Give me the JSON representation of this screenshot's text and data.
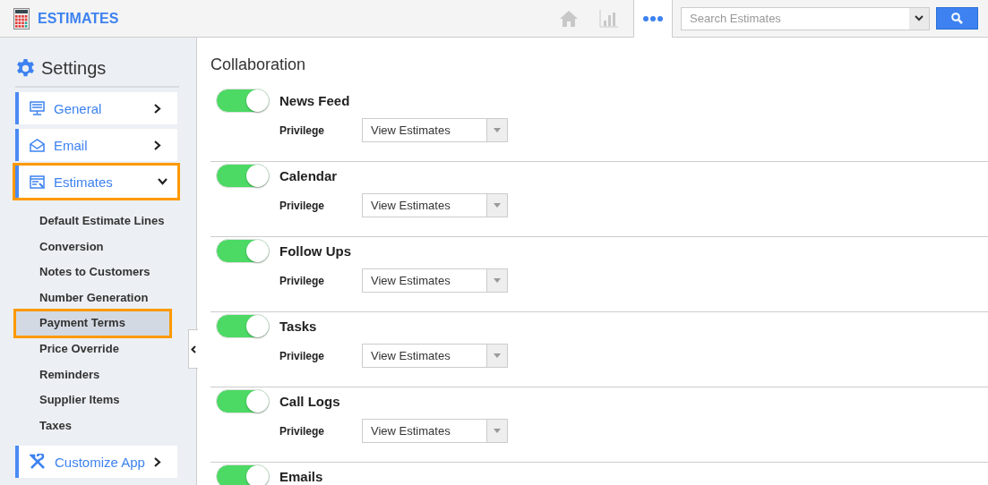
{
  "header": {
    "title": "ESTIMATES",
    "search": {
      "placeholder": "Search Estimates"
    }
  },
  "sidebar": {
    "title": "Settings",
    "items": [
      {
        "kind": "menu",
        "label": "General",
        "expanded": false,
        "highlighted": false
      },
      {
        "kind": "menu",
        "label": "Email",
        "expanded": false,
        "highlighted": false
      },
      {
        "kind": "menu",
        "label": "Estimates",
        "expanded": true,
        "highlighted": true,
        "children": [
          {
            "label": "Default Estimate Lines",
            "selected": false,
            "highlighted": false
          },
          {
            "label": "Conversion",
            "selected": false,
            "highlighted": false
          },
          {
            "label": "Notes to Customers",
            "selected": false,
            "highlighted": false
          },
          {
            "label": "Number Generation",
            "selected": false,
            "highlighted": false
          },
          {
            "label": "Payment Terms",
            "selected": true,
            "highlighted": true
          },
          {
            "label": "Price Override",
            "selected": false,
            "highlighted": false
          },
          {
            "label": "Reminders",
            "selected": false,
            "highlighted": false
          },
          {
            "label": "Supplier Items",
            "selected": false,
            "highlighted": false
          },
          {
            "label": "Taxes",
            "selected": false,
            "highlighted": false
          }
        ]
      },
      {
        "kind": "menu",
        "label": "Customize App",
        "expanded": false,
        "highlighted": false
      }
    ]
  },
  "main": {
    "title": "Collaboration",
    "sections": [
      {
        "name": "News Feed",
        "on": true,
        "privilege_label": "Privilege",
        "privilege": "View Estimates"
      },
      {
        "name": "Calendar",
        "on": true,
        "privilege_label": "Privilege",
        "privilege": "View Estimates"
      },
      {
        "name": "Follow Ups",
        "on": true,
        "privilege_label": "Privilege",
        "privilege": "View Estimates"
      },
      {
        "name": "Tasks",
        "on": true,
        "privilege_label": "Privilege",
        "privilege": "View Estimates"
      },
      {
        "name": "Call Logs",
        "on": true,
        "privilege_label": "Privilege",
        "privilege": "View Estimates"
      },
      {
        "name": "Emails",
        "on": true
      }
    ]
  }
}
